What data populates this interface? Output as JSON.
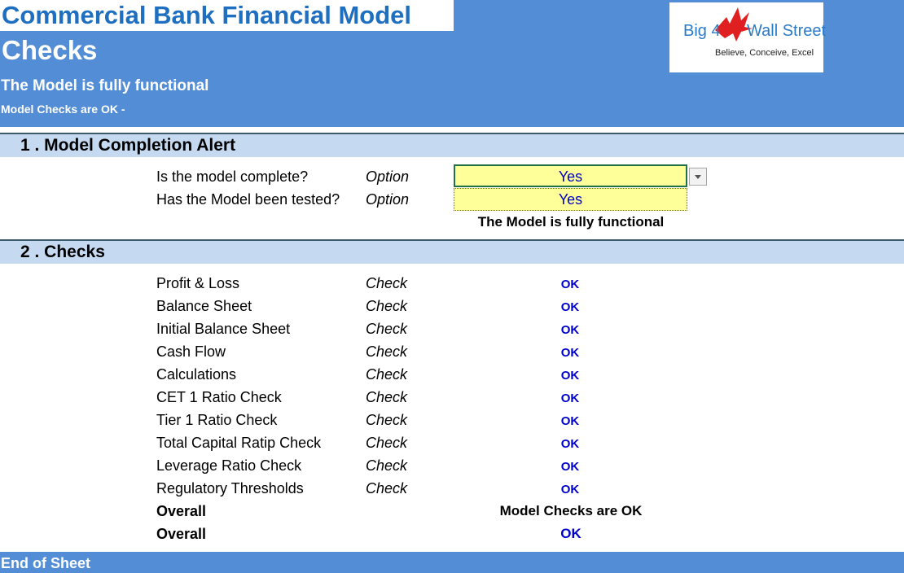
{
  "header": {
    "model_title": "Commercial Bank Financial Model",
    "sheet_title": "Checks",
    "status_line1": "The Model is fully functional",
    "status_line2": "Model Checks are OK -"
  },
  "logo": {
    "text_left": "Big 4",
    "text_right": "Wall Street",
    "tagline": "Believe, Conceive, Excel"
  },
  "section1": {
    "title": "1 . Model Completion Alert",
    "rows": [
      {
        "label": "Is the model complete?",
        "type": "Option",
        "value": "Yes"
      },
      {
        "label": "Has the Model been tested?",
        "type": "Option",
        "value": "Yes"
      }
    ],
    "result": "The Model is fully functional"
  },
  "section2": {
    "title": "2 . Checks",
    "rows": [
      {
        "label": "Profit & Loss",
        "type": "Check",
        "status": "OK"
      },
      {
        "label": "Balance Sheet",
        "type": "Check",
        "status": "OK"
      },
      {
        "label": "Initial Balance Sheet",
        "type": "Check",
        "status": "OK"
      },
      {
        "label": "Cash Flow",
        "type": "Check",
        "status": "OK"
      },
      {
        "label": "Calculations",
        "type": "Check",
        "status": "OK"
      },
      {
        "label": "CET 1 Ratio Check",
        "type": "Check",
        "status": "OK"
      },
      {
        "label": "Tier 1 Ratio Check",
        "type": "Check",
        "status": "OK"
      },
      {
        "label": "Total Capital Ratip Check",
        "type": "Check",
        "status": "OK"
      },
      {
        "label": "Leverage Ratio Check",
        "type": "Check",
        "status": "OK"
      },
      {
        "label": "Regulatory Thresholds",
        "type": "Check",
        "status": "OK"
      }
    ],
    "overall": [
      {
        "label": "Overall",
        "value": "Model Checks are OK"
      },
      {
        "label": "Overall",
        "value": "OK"
      }
    ]
  },
  "footer": {
    "text": "End of Sheet"
  },
  "colors": {
    "header_blue": "#538dd5",
    "section_blue": "#c5d9f1",
    "input_yellow": "#ffff99",
    "ok_blue": "#0000cc"
  }
}
